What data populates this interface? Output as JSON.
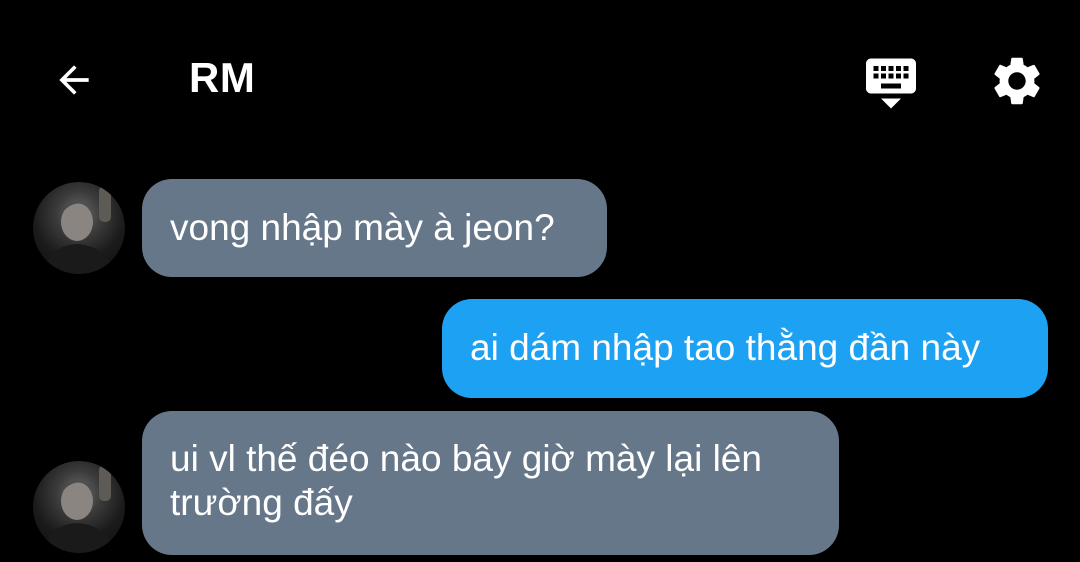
{
  "header": {
    "back_icon": "arrow-left-icon",
    "title": "RM",
    "keyboard_icon": "keyboard-hide-icon",
    "settings_icon": "gear-icon"
  },
  "colors": {
    "background": "#000000",
    "received_bubble": "#66778a",
    "sent_bubble": "#1da1f2",
    "text": "#ffffff"
  },
  "messages": [
    {
      "direction": "received",
      "text": "vong nhập mày à jeon?",
      "avatar": true
    },
    {
      "direction": "sent",
      "text": "ai dám nhập tao thằng đần này",
      "avatar": false
    },
    {
      "direction": "received",
      "text": "ui vl thế đéo nào bây giờ mày lại lên trường đấy",
      "avatar": true
    }
  ]
}
